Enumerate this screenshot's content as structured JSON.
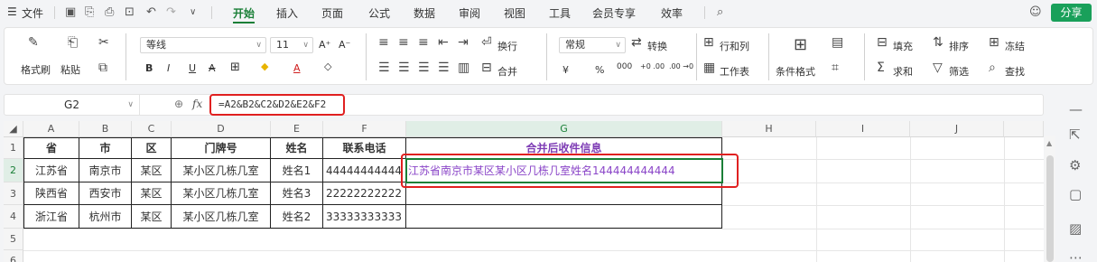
{
  "menubar": {
    "file_label": "文件",
    "tabs": [
      "开始",
      "插入",
      "页面",
      "公式",
      "数据",
      "审阅",
      "视图",
      "工具",
      "会员专享",
      "效率"
    ],
    "share_label": "分享"
  },
  "ribbon": {
    "format_painter": "格式刷",
    "paste": "粘贴",
    "font_name": "等线",
    "font_size": "11",
    "wrap": "换行",
    "number_format": "常规",
    "convert": "转换",
    "rows_cols": "行和列",
    "worksheet": "工作表",
    "merge": "合并",
    "cond_format": "条件格式",
    "fill": "填充",
    "sort": "排序",
    "freeze": "冻结",
    "sum": "求和",
    "filter": "筛选",
    "find": "查找",
    "currency": "¥",
    "percent": "%",
    "thousands": "000",
    "dec_inc": "+0 .00",
    "dec_dec": ".00 →0"
  },
  "formula_bar": {
    "cell_ref": "G2",
    "fx": "fx",
    "formula": "=A2&B2&C2&D2&E2&F2"
  },
  "sheet": {
    "columns": [
      "A",
      "B",
      "C",
      "D",
      "E",
      "F",
      "G",
      "H",
      "I",
      "J"
    ],
    "rows": [
      "1",
      "2",
      "3",
      "4",
      "5",
      "6"
    ],
    "header": [
      "省",
      "市",
      "区",
      "门牌号",
      "姓名",
      "联系电话",
      "合并后收件信息"
    ],
    "data": [
      [
        "江苏省",
        "南京市",
        "某区",
        "某小区几栋几室",
        "姓名1",
        "44444444444",
        "江苏省南京市某区某小区几栋几室姓名144444444444"
      ],
      [
        "陕西省",
        "西安市",
        "某区",
        "某小区几栋几室",
        "姓名3",
        "22222222222",
        ""
      ],
      [
        "浙江省",
        "杭州市",
        "某区",
        "某小区几栋几室",
        "姓名2",
        "33333333333",
        ""
      ]
    ]
  },
  "colors": {
    "accent": "#1a7f37",
    "merged_text": "#8a45c8",
    "highlight": "#e02020"
  }
}
